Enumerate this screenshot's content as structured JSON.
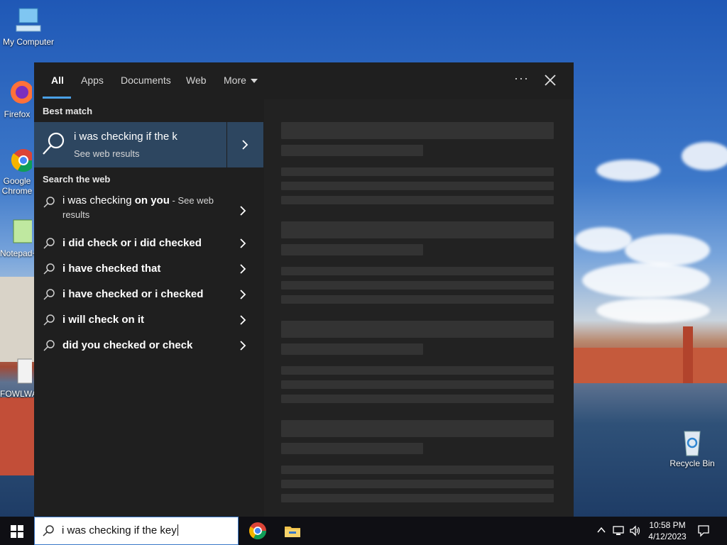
{
  "desktop": {
    "icons": [
      {
        "label": "My Computer"
      },
      {
        "label": "Firefox"
      },
      {
        "label": "Google Chrome"
      },
      {
        "label": "Notepad++"
      },
      {
        "label": "FOWLWAY"
      },
      {
        "label": "Recycle Bin"
      }
    ]
  },
  "search_panel": {
    "tabs": [
      {
        "label": "All",
        "active": true
      },
      {
        "label": "Apps"
      },
      {
        "label": "Documents"
      },
      {
        "label": "Web"
      },
      {
        "label": "More"
      }
    ],
    "more_options_icon": "ellipsis-icon",
    "close_icon": "close-icon",
    "best_match_heading": "Best match",
    "best_match": {
      "title": "i was checking if the k",
      "subtitle": "See web results"
    },
    "search_web_heading": "Search the web",
    "suggestions": [
      {
        "prefix": "i was checking ",
        "bold": "on you",
        "suffix": " - See web results"
      },
      {
        "text": "i did check or i did checked"
      },
      {
        "text": "i have checked that"
      },
      {
        "text": "i have checked or i checked"
      },
      {
        "text": "i will check on it"
      },
      {
        "text": "did you checked or check"
      }
    ]
  },
  "taskbar": {
    "search_value": "i was checking if the key",
    "time": "10:58 PM",
    "date": "4/12/2023"
  },
  "colors": {
    "panel_bg": "#1f1f1f",
    "best_match_bg": "#2d4660",
    "accent": "#4aa0e6",
    "placeholder": "#333333"
  }
}
